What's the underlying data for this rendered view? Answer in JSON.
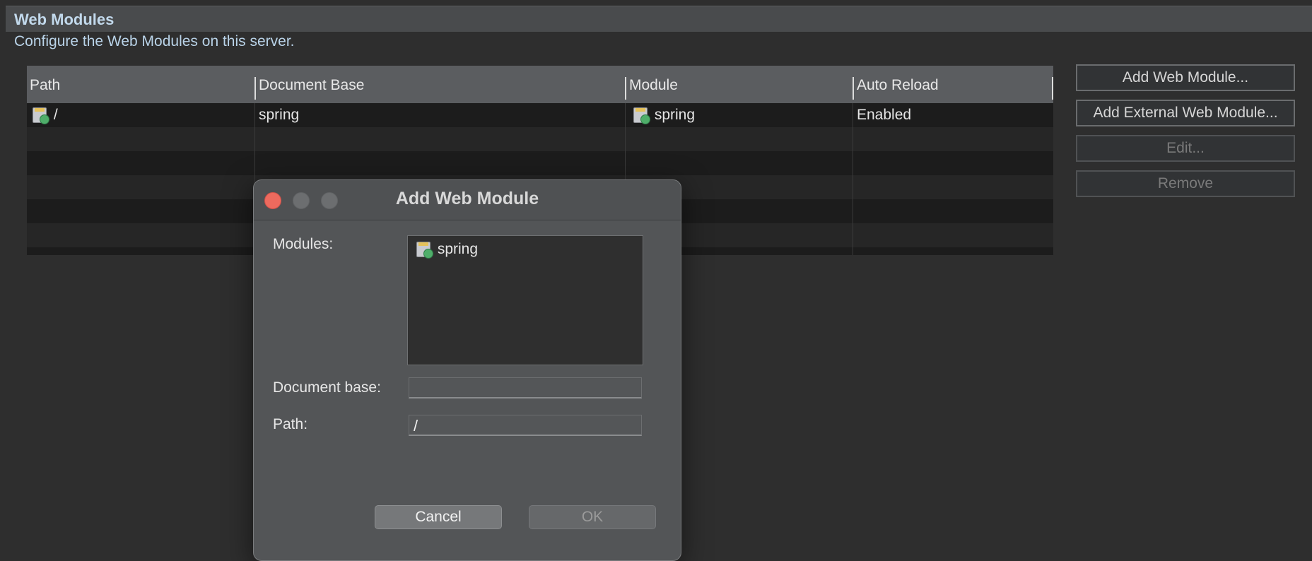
{
  "section": {
    "title": "Web Modules",
    "description": "Configure the Web Modules on this server."
  },
  "table": {
    "columns": [
      "Path",
      "Document Base",
      "Module",
      "Auto Reload"
    ],
    "rows": [
      {
        "path": "/",
        "document_base": "spring",
        "module": "spring",
        "auto_reload": "Enabled",
        "path_icon": "web-module-icon",
        "module_icon": "web-module-icon"
      }
    ]
  },
  "buttons": {
    "add_web_module": "Add Web Module...",
    "add_external_web_module": "Add External Web Module...",
    "edit": "Edit...",
    "remove": "Remove"
  },
  "dialog": {
    "title": "Add Web Module",
    "modules_label": "Modules:",
    "modules": [
      {
        "name": "spring",
        "icon": "web-module-icon"
      }
    ],
    "document_base_label": "Document base:",
    "document_base_value": "",
    "path_label": "Path:",
    "path_value": "/",
    "cancel_label": "Cancel",
    "ok_label": "OK"
  },
  "colors": {
    "close": "#ed6a5e",
    "section_title": "#c2d9ec"
  }
}
